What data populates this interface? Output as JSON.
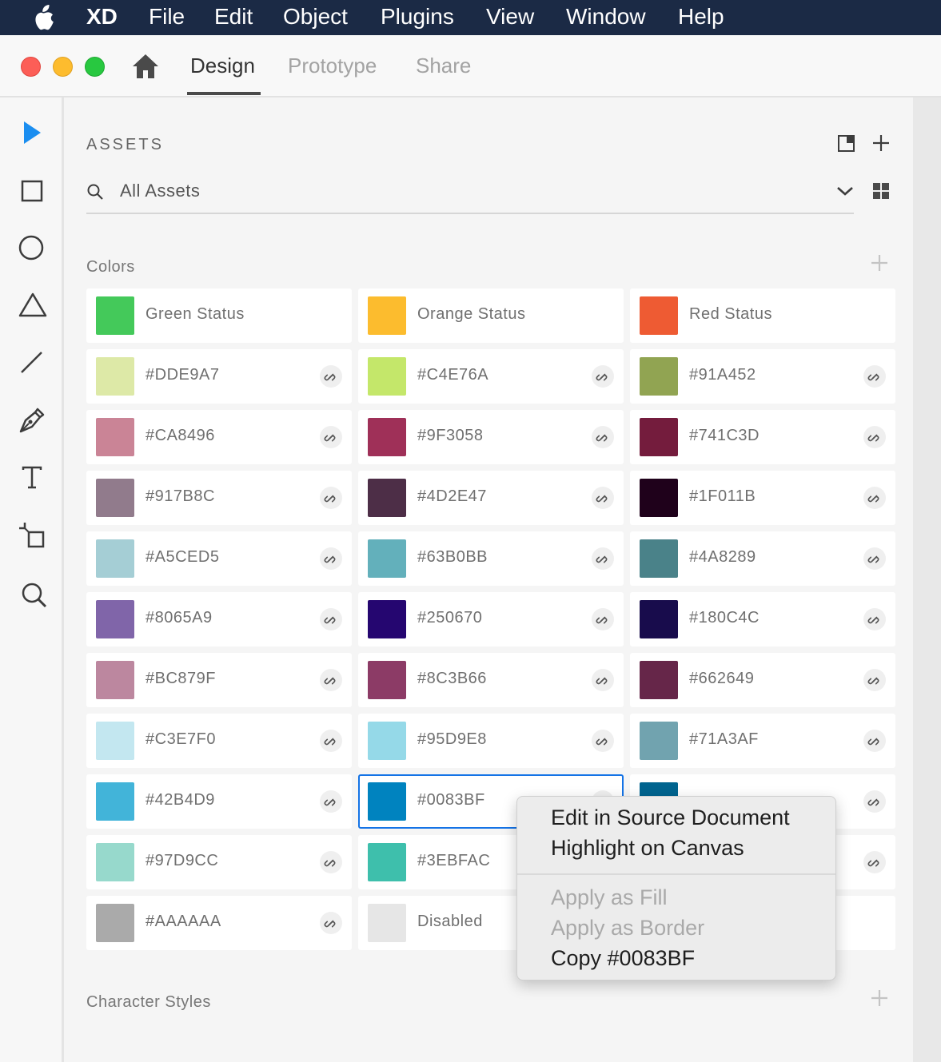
{
  "menubar": {
    "app_name": "XD",
    "items": [
      "File",
      "Edit",
      "Object",
      "Plugins",
      "View",
      "Window",
      "Help"
    ]
  },
  "titlebar": {
    "tabs": [
      {
        "label": "Design",
        "active": true
      },
      {
        "label": "Prototype",
        "active": false
      },
      {
        "label": "Share",
        "active": false
      }
    ]
  },
  "toolbar": {
    "tools": [
      "select-icon",
      "rectangle-icon",
      "ellipse-icon",
      "polygon-icon",
      "line-icon",
      "pen-icon",
      "text-icon",
      "artboard-icon",
      "zoom-icon"
    ]
  },
  "assets": {
    "title": "ASSETS",
    "filter": "All Assets",
    "colors_title": "Colors",
    "character_styles_title": "Character Styles",
    "colors": [
      {
        "label": "Green Status",
        "color": "#44C95A",
        "linked": false
      },
      {
        "label": "Orange Status",
        "color": "#FCBC2E",
        "linked": false
      },
      {
        "label": "Red Status",
        "color": "#EE5B33",
        "linked": false
      },
      {
        "label": "#DDE9A7",
        "color": "#DDE9A7",
        "linked": true
      },
      {
        "label": "#C4E76A",
        "color": "#C4E76A",
        "linked": true
      },
      {
        "label": "#91A452",
        "color": "#91A452",
        "linked": true
      },
      {
        "label": "#CA8496",
        "color": "#CA8496",
        "linked": true
      },
      {
        "label": "#9F3058",
        "color": "#9F3058",
        "linked": true
      },
      {
        "label": "#741C3D",
        "color": "#741C3D",
        "linked": true
      },
      {
        "label": "#917B8C",
        "color": "#917B8C",
        "linked": true
      },
      {
        "label": "#4D2E47",
        "color": "#4D2E47",
        "linked": true
      },
      {
        "label": "#1F011B",
        "color": "#1F011B",
        "linked": true
      },
      {
        "label": "#A5CED5",
        "color": "#A5CED5",
        "linked": true
      },
      {
        "label": "#63B0BB",
        "color": "#63B0BB",
        "linked": true
      },
      {
        "label": "#4A8289",
        "color": "#4A8289",
        "linked": true
      },
      {
        "label": "#8065A9",
        "color": "#8065A9",
        "linked": true
      },
      {
        "label": "#250670",
        "color": "#250670",
        "linked": true
      },
      {
        "label": "#180C4C",
        "color": "#180C4C",
        "linked": true
      },
      {
        "label": "#BC879F",
        "color": "#BC879F",
        "linked": true
      },
      {
        "label": "#8C3B66",
        "color": "#8C3B66",
        "linked": true
      },
      {
        "label": "#662649",
        "color": "#662649",
        "linked": true
      },
      {
        "label": "#C3E7F0",
        "color": "#C3E7F0",
        "linked": true
      },
      {
        "label": "#95D9E8",
        "color": "#95D9E8",
        "linked": true
      },
      {
        "label": "#71A3AF",
        "color": "#71A3AF",
        "linked": true
      },
      {
        "label": "#42B4D9",
        "color": "#42B4D9",
        "linked": true
      },
      {
        "label": "#0083BF",
        "color": "#0083BF",
        "linked": true,
        "selected": true
      },
      {
        "label": "",
        "color": "#00648F",
        "linked": true
      },
      {
        "label": "#97D9CC",
        "color": "#97D9CC",
        "linked": true
      },
      {
        "label": "#3EBFAC",
        "color": "#3EBFAC",
        "linked": true
      },
      {
        "label": "",
        "color": "",
        "linked": true
      },
      {
        "label": "#AAAAAA",
        "color": "#AAAAAA",
        "linked": true
      },
      {
        "label": "Disabled",
        "color": "#E6E6E6",
        "linked": false
      },
      {
        "label": "",
        "color": "",
        "linked": false
      }
    ]
  },
  "context_menu": {
    "items": [
      {
        "label": "Edit in Source Document",
        "enabled": true
      },
      {
        "label": "Highlight on Canvas",
        "enabled": true
      },
      {
        "label": "Apply as Fill",
        "enabled": false
      },
      {
        "label": "Apply as Border",
        "enabled": false
      },
      {
        "label": "Copy #0083BF",
        "enabled": true
      }
    ]
  },
  "colors": {
    "menubar_bg": "#1b2a45",
    "accent": "#1473e6",
    "traffic_close": "#fc5e57",
    "traffic_minimize": "#fdbc2e",
    "traffic_zoom": "#28c840",
    "select_tool": "#1b8ef0"
  }
}
